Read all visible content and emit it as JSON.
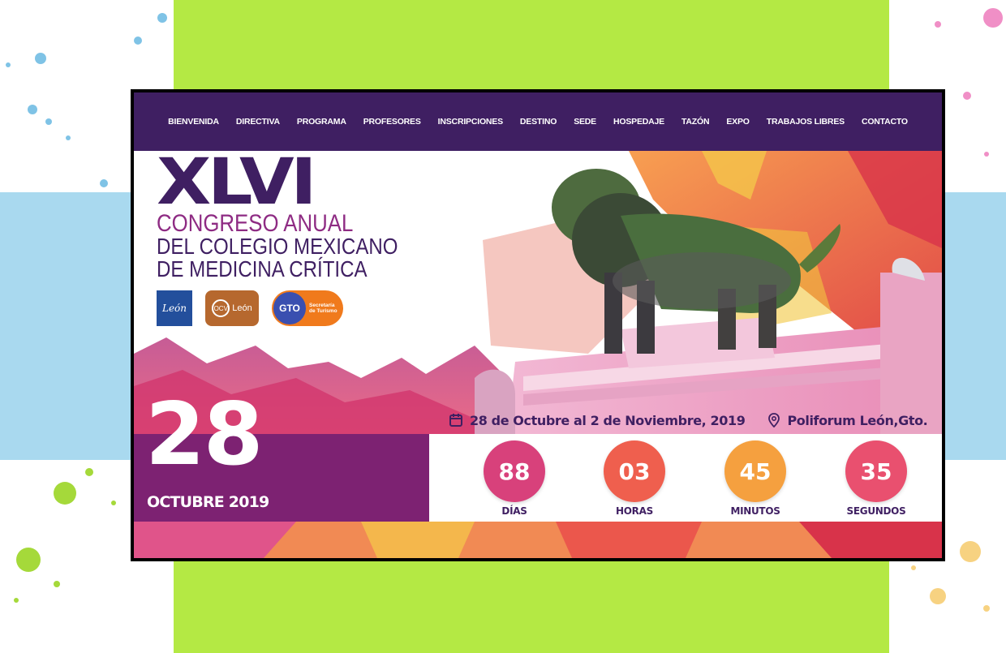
{
  "nav": {
    "items": [
      "BIENVENIDA",
      "DIRECTIVA",
      "PROGRAMA",
      "PROFESORES",
      "INSCRIPCIONES",
      "DESTINO",
      "SEDE",
      "HOSPEDAJE",
      "TAZÓN",
      "EXPO",
      "TRABAJOS LIBRES",
      "CONTACTO"
    ]
  },
  "hero": {
    "edition": "XLVI",
    "line1": "CONGRESO ANUAL",
    "line2": "DEL COLEGIO MEXICANO",
    "line3": "DE MEDICINA CRÍTICA"
  },
  "logos": {
    "leon": "León",
    "ocv_ring": "OCV",
    "ocv_text": "León",
    "gto": "GTO",
    "gto_text_1": "Secretaría",
    "gto_text_2": "de Turismo"
  },
  "date": {
    "day": "28",
    "month_year": "OCTUBRE 2019"
  },
  "event": {
    "dates": "28 de Octubre al 2 de Noviembre, 2019",
    "venue": "Poliforum León,Gto.",
    "calendar_icon": "calendar-icon",
    "location_icon": "map-pin-icon"
  },
  "countdown": {
    "days": {
      "value": "88",
      "label": "DÍAS",
      "color": "#d8417b"
    },
    "hours": {
      "value": "03",
      "label": "HORAS",
      "color": "#ef5f4e"
    },
    "minutes": {
      "value": "45",
      "label": "MINUTOS",
      "color": "#f5a03f"
    },
    "seconds": {
      "value": "35",
      "label": "SEGUNDOS",
      "color": "#e9506f"
    }
  },
  "colors": {
    "nav_bg": "#3f1f62",
    "accent_purple": "#7d2272",
    "page_green": "#b4e944",
    "page_blue": "#a9d9ef"
  }
}
